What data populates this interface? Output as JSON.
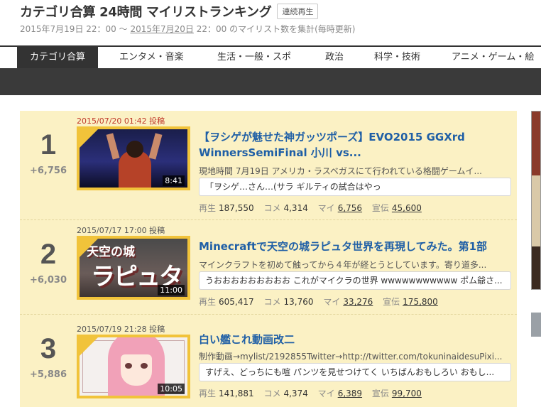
{
  "header": {
    "title": "カテゴリ合算 24時間 マイリストランキング",
    "continuous_play": "連続再生",
    "period_start": "2015年7月19日 22：00",
    "period_sep": " 〜 ",
    "period_end_date": "2015年7月20日",
    "period_end_time": " 22：00 のマイリスト数を集計(毎時更新)"
  },
  "nav": {
    "tabs": [
      {
        "label": "カテゴリ合算",
        "active": true
      },
      {
        "label": "エンタメ・音楽"
      },
      {
        "label": "生活・一般・スポ"
      },
      {
        "label": "政治"
      },
      {
        "label": "科学・技術"
      },
      {
        "label": "アニメ・ゲーム・絵"
      }
    ]
  },
  "items": [
    {
      "rank": "1",
      "change": "+6,756",
      "posted": "2015/07/20 01:42 投稿",
      "length": "8:41",
      "title": "【ヲシゲが魅せた神ガッツポーズ】EVO2015 GGXrd WinnersSemiFinal 小川 vs...",
      "description": "現地時間 7月19日 アメリカ・ラスベガスにて行われている格闘ゲームイ...",
      "comment": "「ヲシゲ…さん…(サラ ギルティの試合はやっ",
      "stats": {
        "views_label": "再生",
        "views": "187,550",
        "comments_label": "コメ",
        "comments": "4,314",
        "mylist_label": "マイ",
        "mylist": "6,756",
        "ad_label": "宣伝",
        "ad": "45,600"
      }
    },
    {
      "rank": "2",
      "change": "+6,030",
      "posted": "2015/07/17 17:00 投稿",
      "length": "11:00",
      "thumb_text1": "天空の城",
      "thumb_text2": "ラピュタ",
      "title": "Minecraftで天空の城ラピュタ世界を再現してみた。第1部",
      "description": "マインクラフトを初めて触ってから４年が経とうとしています。寄り道多...",
      "comment": "うおおおおおおおおお これがマイクラの世界 wwwwwwwwwww ポム爺さ...",
      "stats": {
        "views_label": "再生",
        "views": "605,417",
        "comments_label": "コメ",
        "comments": "13,760",
        "mylist_label": "マイ",
        "mylist": "33,276",
        "ad_label": "宣伝",
        "ad": "175,800"
      }
    },
    {
      "rank": "3",
      "change": "+5,886",
      "posted": "2015/07/19 21:28 投稿",
      "length": "10:05",
      "title": "白い艦これ動画改二",
      "description": "制作動画→mylist/2192855Twitter→http://twitter.com/tokuninaidesuPixi...",
      "comment": "すげえ、どっちにも喧 パンツを見せつけてく いちばんおもしろい おもし...",
      "stats": {
        "views_label": "再生",
        "views": "141,881",
        "comments_label": "コメ",
        "comments": "4,374",
        "mylist_label": "マイ",
        "mylist": "6,389",
        "ad_label": "宣伝",
        "ad": "99,700"
      }
    }
  ]
}
